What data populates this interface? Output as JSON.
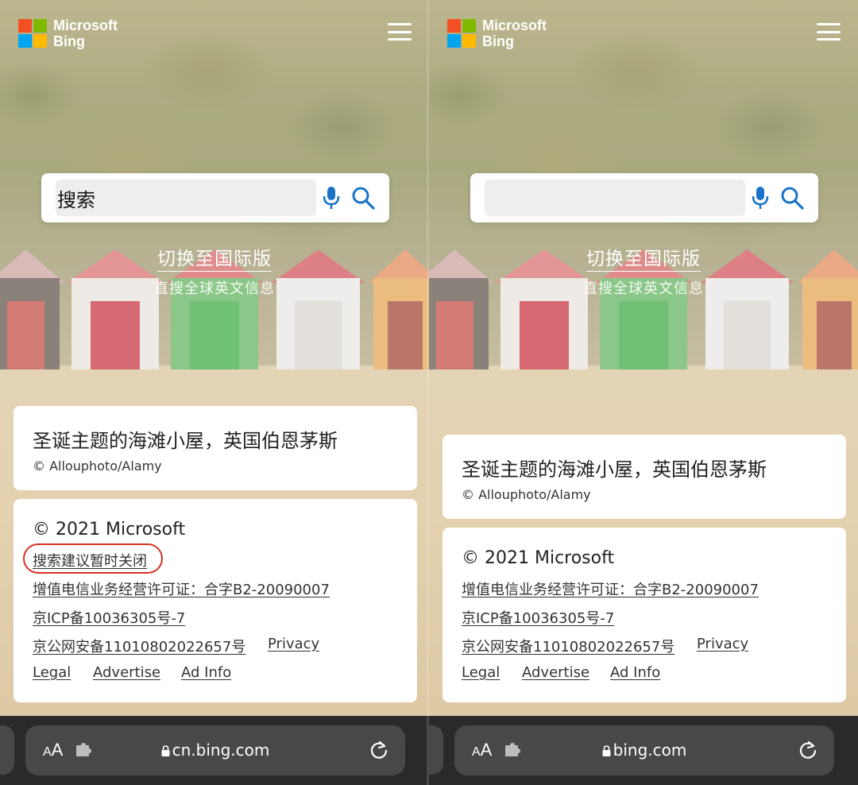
{
  "colors": {
    "ms_red": "#f25022",
    "ms_green": "#7fba00",
    "ms_blue": "#00a4ef",
    "ms_yellow": "#ffb900",
    "icon_blue": "#1a73c8",
    "annotation_red": "#d93025"
  },
  "brand": {
    "line1": "Microsoft",
    "line2": "Bing"
  },
  "left": {
    "search_text": "搜索",
    "switch_label": "切换至国际版",
    "switch_sub": "直搜全球英文信息",
    "image_title": "圣诞主题的海滩小屋，英国伯恩茅斯",
    "image_credit": "© Allouphoto/Alamy",
    "copyright": "© 2021 Microsoft",
    "suggest_off": "搜索建议暂时关闭",
    "license": "增值电信业务经营许可证：合字B2-20090007",
    "icp": "京ICP备10036305号-7",
    "police": "京公网安备11010802022657号",
    "privacy": "Privacy",
    "legal": "Legal",
    "advertise": "Advertise",
    "adinfo": "Ad Info",
    "url": "cn.bing.com",
    "aa_small": "A",
    "aa_big": "A"
  },
  "right": {
    "search_text": "",
    "switch_label": "切换至国际版",
    "switch_sub": "直搜全球英文信息",
    "image_title": "圣诞主题的海滩小屋，英国伯恩茅斯",
    "image_credit": "© Allouphoto/Alamy",
    "copyright": "© 2021 Microsoft",
    "license": "增值电信业务经营许可证：合字B2-20090007",
    "icp": "京ICP备10036305号-7",
    "police": "京公网安备11010802022657号",
    "privacy": "Privacy",
    "legal": "Legal",
    "advertise": "Advertise",
    "adinfo": "Ad Info",
    "url": "bing.com",
    "aa_small": "A",
    "aa_big": "A"
  }
}
